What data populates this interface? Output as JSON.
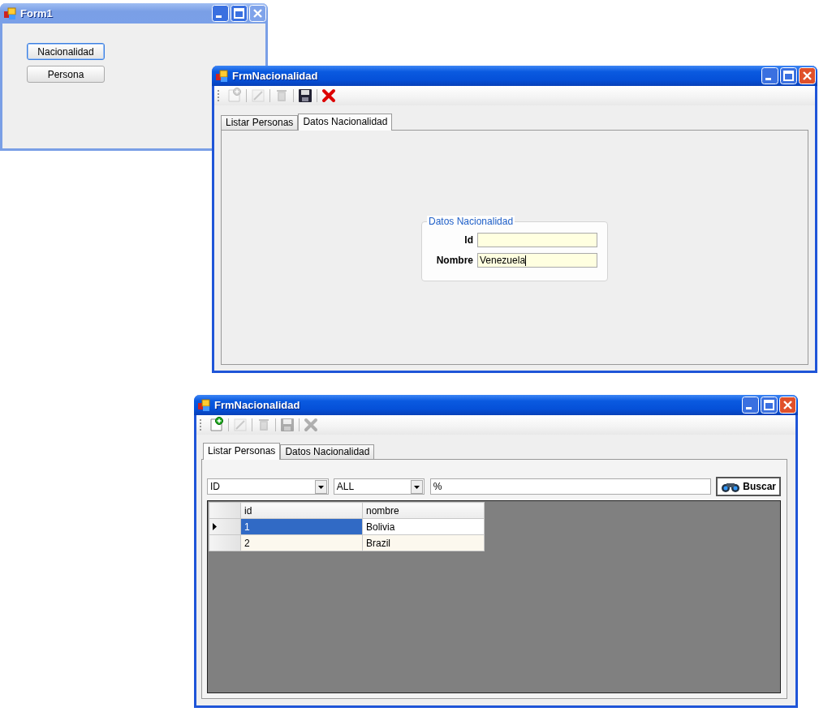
{
  "windows": [
    {
      "kind": "launcher",
      "title": "Form1",
      "active": false,
      "buttons": [
        {
          "label": "Nacionalidad",
          "focused": true
        },
        {
          "label": "Persona",
          "focused": false
        }
      ]
    },
    {
      "kind": "editor",
      "title": "FrmNacionalidad",
      "active": true,
      "toolbar": [
        {
          "kind": "new",
          "disabled": true
        },
        {
          "kind": "edit",
          "disabled": true
        },
        {
          "kind": "delete",
          "disabled": true
        },
        {
          "kind": "save",
          "disabled": false
        },
        {
          "kind": "cancel",
          "disabled": false
        }
      ],
      "tabs": [
        {
          "label": "Listar Personas",
          "selected": false
        },
        {
          "label": "Datos Nacionalidad",
          "selected": true
        }
      ],
      "group": {
        "title": "Datos Nacionalidad",
        "fields": [
          {
            "label": "Id",
            "focused": false
          },
          {
            "label": "Nombre",
            "value": "Venezuela",
            "focused": true
          }
        ]
      }
    },
    {
      "kind": "list",
      "title": "FrmNacionalidad",
      "active": true,
      "toolbar": [
        {
          "kind": "new",
          "disabled": false
        },
        {
          "kind": "edit",
          "disabled": true
        },
        {
          "kind": "delete",
          "disabled": true
        },
        {
          "kind": "save",
          "disabled": true
        },
        {
          "kind": "cancel",
          "disabled": true
        }
      ],
      "tabs": [
        {
          "label": "Listar Personas",
          "selected": true
        },
        {
          "label": "Datos Nacionalidad",
          "selected": false
        }
      ],
      "filter": {
        "field": "ID",
        "operator": "ALL",
        "search": "%",
        "button": "Buscar"
      },
      "table": {
        "columns": [
          "id",
          "nombre"
        ],
        "rows": [
          {
            "cells": [
              "1",
              "Bolivia"
            ],
            "selected": true
          },
          {
            "cells": [
              "2",
              "Brazil"
            ],
            "selected": false
          }
        ]
      }
    }
  ]
}
